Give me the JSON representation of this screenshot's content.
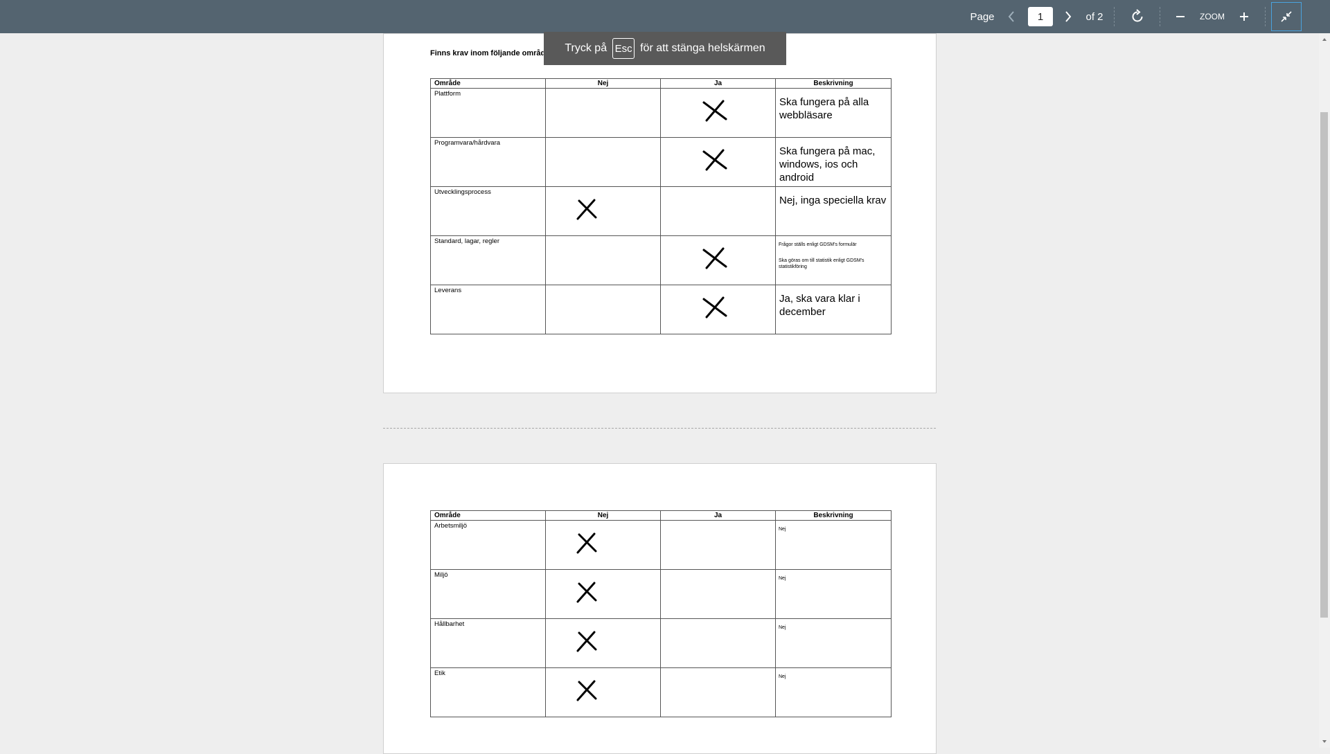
{
  "toolbar": {
    "page_label": "Page",
    "current_page": "1",
    "total_pages": "of 2",
    "zoom_label": "ZOOM"
  },
  "fullscreen_notice": {
    "prefix": "Tryck på",
    "key": "Esc",
    "suffix": "för att stänga helskärmen"
  },
  "document": {
    "question": "Finns krav inom följande områden?\"",
    "headers": [
      "Område",
      "Nej",
      "Ja",
      "Beskrivning"
    ],
    "table1": [
      {
        "area": "Plattform",
        "mark": "ja",
        "description": [
          "Ska fungera på alla",
          "webbläsare"
        ],
        "size": "big"
      },
      {
        "area": "Programvara/hårdvara",
        "mark": "ja",
        "description": [
          "Ska fungera på mac,",
          "windows, ios och",
          "android"
        ],
        "size": "big"
      },
      {
        "area": "Utvecklingsprocess",
        "mark": "nej",
        "description": [
          "Nej, inga speciella krav"
        ],
        "size": "big"
      },
      {
        "area": "Standard, lagar, regler",
        "mark": "ja",
        "description": [
          "Frågor ställs enligt GDSM's formulär",
          "Ska göras om till statistik enligt GDSM's statistikföring"
        ],
        "size": "tiny"
      },
      {
        "area": "Leverans",
        "mark": "ja",
        "description": [
          "Ja, ska vara klar i",
          "december"
        ],
        "size": "big"
      }
    ],
    "table2": [
      {
        "area": "Arbetsmiljö",
        "mark": "nej",
        "description": [
          "Nej"
        ],
        "size": "tiny"
      },
      {
        "area": "Miljö",
        "mark": "nej",
        "description": [
          "Nej"
        ],
        "size": "tiny"
      },
      {
        "area": "Hållbarhet",
        "mark": "nej",
        "description": [
          "Nej"
        ],
        "size": "tiny"
      },
      {
        "area": "Etik",
        "mark": "nej",
        "description": [
          "Nej"
        ],
        "size": "tiny"
      }
    ]
  }
}
